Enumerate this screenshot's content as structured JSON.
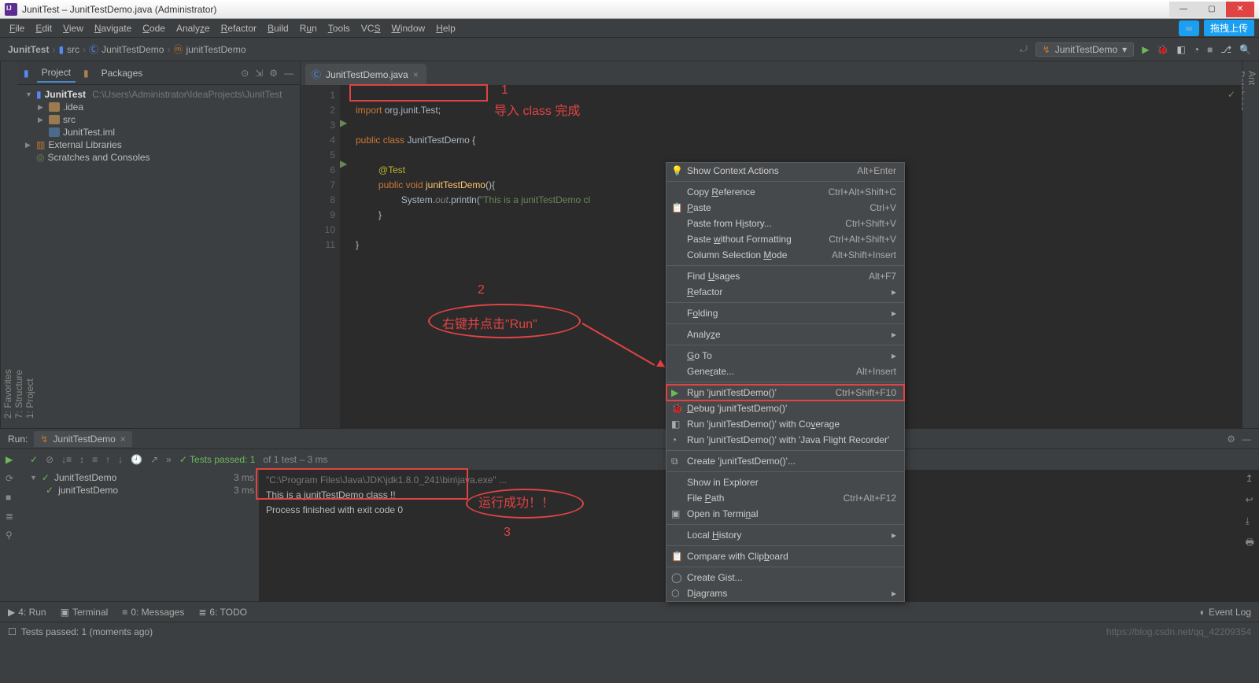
{
  "titlebar": {
    "title": "JunitTest – JunitTestDemo.java (Administrator)"
  },
  "menubar": {
    "items_html": [
      "<u>F</u>ile",
      "<u>E</u>dit",
      "<u>V</u>iew",
      "<u>N</u>avigate",
      "<u>C</u>ode",
      "Analy<u>z</u>e",
      "<u>R</u>efactor",
      "<u>B</u>uild",
      "R<u>u</u>n",
      "<u>T</u>ools",
      "VC<u>S</u>",
      "<u>W</u>indow",
      "<u>H</u>elp"
    ],
    "upload_label": "拖拽上传"
  },
  "breadcrumbs": {
    "project": "JunitTest",
    "folder": "src",
    "class": "JunitTestDemo",
    "method": "junitTestDemo"
  },
  "runconfig": {
    "name": "JunitTestDemo"
  },
  "projpanel": {
    "tabs": [
      "Project",
      "Packages"
    ],
    "root": {
      "name": "JunitTest",
      "path": "C:\\Users\\Administrator\\IdeaProjects\\JunitTest"
    },
    "rows": [
      {
        "ind": "ind1",
        "arrow": "▶",
        "icon": "folder",
        "label": ".idea"
      },
      {
        "ind": "ind1",
        "arrow": "▶",
        "icon": "folder",
        "label": "src"
      },
      {
        "ind": "ind1",
        "arrow": "",
        "icon": "module",
        "label": "JunitTest.iml"
      }
    ],
    "ext_lib": "External Libraries",
    "scratches": "Scratches and Consoles"
  },
  "leftstrip": [
    "2: Favorites",
    "7: Structure",
    "1: Project"
  ],
  "rightstrip": [
    "Ant",
    "Database"
  ],
  "editor": {
    "tab": "JunitTestDemo.java",
    "lines": [
      1,
      2,
      3,
      4,
      5,
      6,
      7,
      8,
      9,
      10,
      11
    ],
    "code": {
      "l1_kw": "import ",
      "l1_pkg": "org.junit.Test",
      "l1_semi": ";",
      "l3": "public class ",
      "l3_cls": "JunitTestDemo ",
      "l3_brace": "{",
      "l5": "@Test",
      "l6_kw": "public void ",
      "l6_fn": "junitTestDemo",
      "l6_paren": "(){",
      "l7_a": "System.",
      "l7_b": "out",
      "l7_c": ".println(",
      "l7_str": "\"This is a junitTestDemo cl",
      "l8": "}",
      "l10": "}"
    }
  },
  "contextmenu": [
    {
      "icon": "bulb",
      "label_html": "Show Context Actions",
      "sc": "Alt+Enter"
    },
    {
      "sep": true
    },
    {
      "label_html": "Copy <u>R</u>eference",
      "sc": "Ctrl+Alt+Shift+C"
    },
    {
      "icon": "paste",
      "label_html": "<u>P</u>aste",
      "sc": "Ctrl+V"
    },
    {
      "label_html": "Paste from H<u>i</u>story...",
      "sc": "Ctrl+Shift+V"
    },
    {
      "label_html": "Paste <u>w</u>ithout Formatting",
      "sc": "Ctrl+Alt+Shift+V"
    },
    {
      "label_html": "Column Selection <u>M</u>ode",
      "sc": "Alt+Shift+Insert"
    },
    {
      "sep": true
    },
    {
      "label_html": "Find <u>U</u>sages",
      "sc": "Alt+F7"
    },
    {
      "label_html": "<u>R</u>efactor",
      "sub": "▸"
    },
    {
      "sep": true
    },
    {
      "label_html": "F<u>o</u>lding",
      "sub": "▸"
    },
    {
      "sep": true
    },
    {
      "label_html": "Analy<u>z</u>e",
      "sub": "▸"
    },
    {
      "sep": true
    },
    {
      "label_html": "<u>G</u>o To",
      "sub": "▸"
    },
    {
      "label_html": "Gene<u>r</u>ate...",
      "sc": "Alt+Insert"
    },
    {
      "sep": true
    },
    {
      "hl": true,
      "icon": "play",
      "label_html": "R<u>u</u>n 'junitTestDemo()'",
      "sc": "Ctrl+Shift+F10"
    },
    {
      "icon": "bug",
      "label_html": "<u>D</u>ebug 'junitTestDemo()'"
    },
    {
      "icon": "cover",
      "label_html": "Run 'junitTestDemo()' with Co<u>v</u>erage"
    },
    {
      "icon": "jfr",
      "label_html": "Run 'junitTestDemo()' with 'Java Flight Recorder'"
    },
    {
      "sep": true
    },
    {
      "icon": "creat",
      "label_html": "Create 'junitTestDemo()'..."
    },
    {
      "sep": true
    },
    {
      "label_html": "Show in Explorer"
    },
    {
      "label_html": "File <u>P</u>ath",
      "sc": "Ctrl+Alt+F12"
    },
    {
      "icon": "term",
      "label_html": "Open in Termi<u>n</u>al"
    },
    {
      "sep": true
    },
    {
      "label_html": "Local <u>H</u>istory",
      "sub": "▸"
    },
    {
      "sep": true
    },
    {
      "icon": "clip",
      "label_html": "Compare with Clip<u>b</u>oard"
    },
    {
      "sep": true
    },
    {
      "icon": "gh",
      "label_html": "Create Gist..."
    },
    {
      "icon": "diag",
      "label_html": "D<u>i</u>agrams",
      "sub": "▸"
    }
  ],
  "annotations": {
    "n1": "1",
    "t1": "导入 class 完成",
    "n2": "2",
    "t2": "右键并点击\"Run\"",
    "n3": "3",
    "t3": "运行成功！！"
  },
  "runpanel": {
    "label": "Run:",
    "tab": "JunitTestDemo",
    "passed": "✓ Tests passed: 1",
    "passed_suffix": " of 1 test – 3 ms",
    "tree": [
      {
        "ind": 0,
        "label": "JunitTestDemo",
        "time": "3 ms"
      },
      {
        "ind": 1,
        "label": "junitTestDemo",
        "time": "3 ms"
      }
    ],
    "out_l1": "\"C:\\Program Files\\Java\\JDK\\jdk1.8.0_241\\bin\\java.exe\" ...",
    "out_l2": "This is a junitTestDemo class !!",
    "out_l3": "",
    "out_l4": "Process finished with exit code 0"
  },
  "bottomtabs": {
    "run": "4: Run",
    "term": "Terminal",
    "msg": "0: Messages",
    "todo": "6: TODO",
    "ev": "Event Log"
  },
  "status": {
    "text": "Tests passed: 1 (moments ago)",
    "url": "https://blog.csdn.net/qq_42209354"
  }
}
